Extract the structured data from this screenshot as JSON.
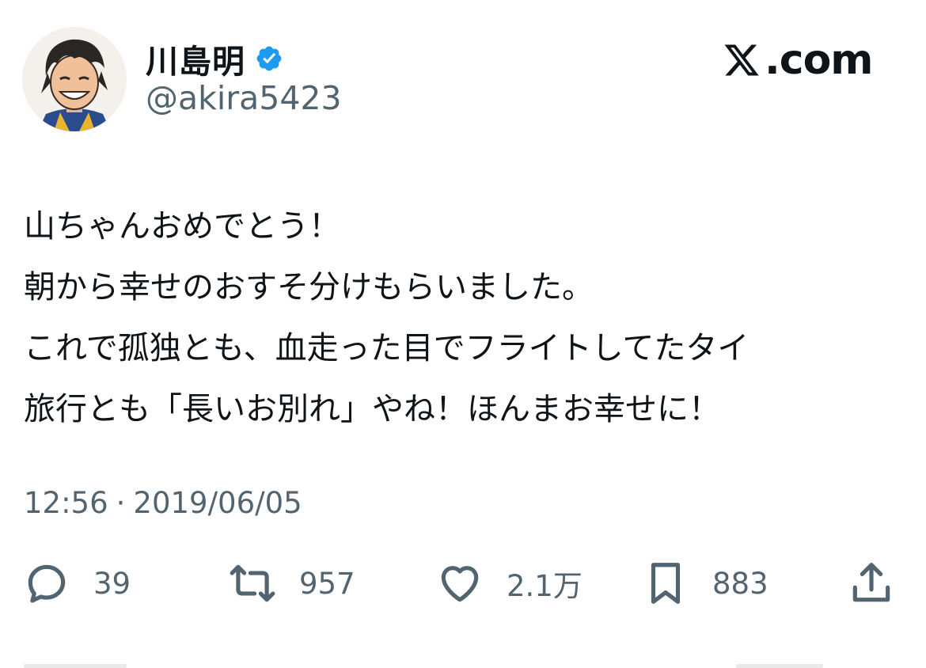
{
  "author": {
    "display_name": "川島明",
    "handle": "@akira5423",
    "verified_icon": "verified-badge-icon"
  },
  "brand": {
    "logo_icon": "x-logo-icon",
    "suffix": ".com"
  },
  "tweet": {
    "lines": [
      "山ちゃんおめでとう！",
      "朝から幸せのおすそ分けもらいました。",
      "これで孤独とも、血走った目でフライトしてたタイ",
      "旅行とも「長いお別れ」やね！ほんまお幸せに！"
    ],
    "time": "12:56",
    "separator": "·",
    "date": "2019/06/05"
  },
  "actions": {
    "reply": {
      "icon": "reply-icon",
      "count": "39"
    },
    "retweet": {
      "icon": "retweet-icon",
      "count": "957"
    },
    "like": {
      "icon": "heart-icon",
      "count": "2.1万"
    },
    "bookmark": {
      "icon": "bookmark-icon",
      "count": "883"
    },
    "share": {
      "icon": "share-icon"
    }
  },
  "colors": {
    "text_primary": "#0f1419",
    "text_secondary": "#536471",
    "verified_blue": "#1d9bf0",
    "background": "#ffffff"
  }
}
